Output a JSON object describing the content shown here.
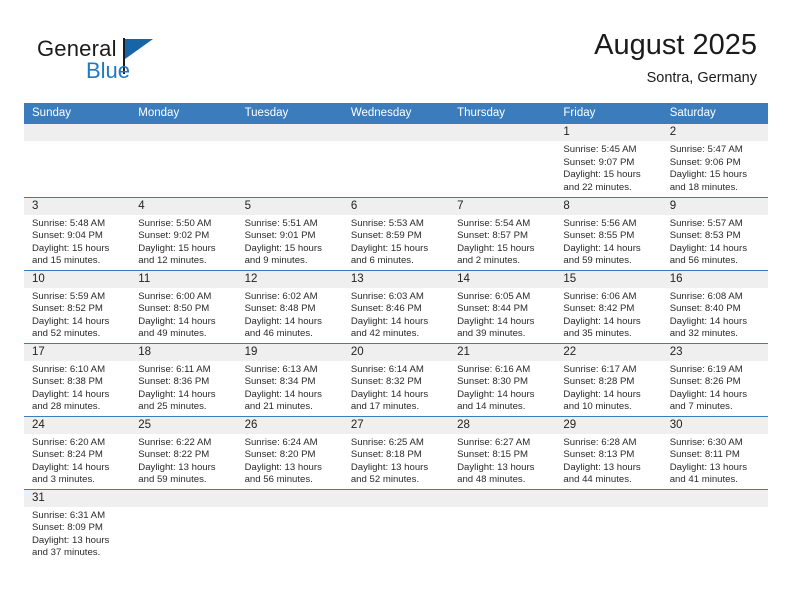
{
  "brand": {
    "name_part1": "General",
    "name_part2": "Blue",
    "flag_icon": "triangle-flag-icon",
    "accent_color": "#2079c7"
  },
  "header": {
    "title": "August 2025",
    "subtitle": "Sontra, Germany"
  },
  "theme": {
    "header_blue": "#3b7cbd",
    "daynum_band": "#efefef",
    "text": "#2a2a2a"
  },
  "weekdays": [
    "Sunday",
    "Monday",
    "Tuesday",
    "Wednesday",
    "Thursday",
    "Friday",
    "Saturday"
  ],
  "weeks": [
    [
      {
        "day": "",
        "sunrise": "",
        "sunset": "",
        "daylight_line1": "",
        "daylight_line2": ""
      },
      {
        "day": "",
        "sunrise": "",
        "sunset": "",
        "daylight_line1": "",
        "daylight_line2": ""
      },
      {
        "day": "",
        "sunrise": "",
        "sunset": "",
        "daylight_line1": "",
        "daylight_line2": ""
      },
      {
        "day": "",
        "sunrise": "",
        "sunset": "",
        "daylight_line1": "",
        "daylight_line2": ""
      },
      {
        "day": "",
        "sunrise": "",
        "sunset": "",
        "daylight_line1": "",
        "daylight_line2": ""
      },
      {
        "day": "1",
        "sunrise": "Sunrise: 5:45 AM",
        "sunset": "Sunset: 9:07 PM",
        "daylight_line1": "Daylight: 15 hours",
        "daylight_line2": "and 22 minutes."
      },
      {
        "day": "2",
        "sunrise": "Sunrise: 5:47 AM",
        "sunset": "Sunset: 9:06 PM",
        "daylight_line1": "Daylight: 15 hours",
        "daylight_line2": "and 18 minutes."
      }
    ],
    [
      {
        "day": "3",
        "sunrise": "Sunrise: 5:48 AM",
        "sunset": "Sunset: 9:04 PM",
        "daylight_line1": "Daylight: 15 hours",
        "daylight_line2": "and 15 minutes."
      },
      {
        "day": "4",
        "sunrise": "Sunrise: 5:50 AM",
        "sunset": "Sunset: 9:02 PM",
        "daylight_line1": "Daylight: 15 hours",
        "daylight_line2": "and 12 minutes."
      },
      {
        "day": "5",
        "sunrise": "Sunrise: 5:51 AM",
        "sunset": "Sunset: 9:01 PM",
        "daylight_line1": "Daylight: 15 hours",
        "daylight_line2": "and 9 minutes."
      },
      {
        "day": "6",
        "sunrise": "Sunrise: 5:53 AM",
        "sunset": "Sunset: 8:59 PM",
        "daylight_line1": "Daylight: 15 hours",
        "daylight_line2": "and 6 minutes."
      },
      {
        "day": "7",
        "sunrise": "Sunrise: 5:54 AM",
        "sunset": "Sunset: 8:57 PM",
        "daylight_line1": "Daylight: 15 hours",
        "daylight_line2": "and 2 minutes."
      },
      {
        "day": "8",
        "sunrise": "Sunrise: 5:56 AM",
        "sunset": "Sunset: 8:55 PM",
        "daylight_line1": "Daylight: 14 hours",
        "daylight_line2": "and 59 minutes."
      },
      {
        "day": "9",
        "sunrise": "Sunrise: 5:57 AM",
        "sunset": "Sunset: 8:53 PM",
        "daylight_line1": "Daylight: 14 hours",
        "daylight_line2": "and 56 minutes."
      }
    ],
    [
      {
        "day": "10",
        "sunrise": "Sunrise: 5:59 AM",
        "sunset": "Sunset: 8:52 PM",
        "daylight_line1": "Daylight: 14 hours",
        "daylight_line2": "and 52 minutes."
      },
      {
        "day": "11",
        "sunrise": "Sunrise: 6:00 AM",
        "sunset": "Sunset: 8:50 PM",
        "daylight_line1": "Daylight: 14 hours",
        "daylight_line2": "and 49 minutes."
      },
      {
        "day": "12",
        "sunrise": "Sunrise: 6:02 AM",
        "sunset": "Sunset: 8:48 PM",
        "daylight_line1": "Daylight: 14 hours",
        "daylight_line2": "and 46 minutes."
      },
      {
        "day": "13",
        "sunrise": "Sunrise: 6:03 AM",
        "sunset": "Sunset: 8:46 PM",
        "daylight_line1": "Daylight: 14 hours",
        "daylight_line2": "and 42 minutes."
      },
      {
        "day": "14",
        "sunrise": "Sunrise: 6:05 AM",
        "sunset": "Sunset: 8:44 PM",
        "daylight_line1": "Daylight: 14 hours",
        "daylight_line2": "and 39 minutes."
      },
      {
        "day": "15",
        "sunrise": "Sunrise: 6:06 AM",
        "sunset": "Sunset: 8:42 PM",
        "daylight_line1": "Daylight: 14 hours",
        "daylight_line2": "and 35 minutes."
      },
      {
        "day": "16",
        "sunrise": "Sunrise: 6:08 AM",
        "sunset": "Sunset: 8:40 PM",
        "daylight_line1": "Daylight: 14 hours",
        "daylight_line2": "and 32 minutes."
      }
    ],
    [
      {
        "day": "17",
        "sunrise": "Sunrise: 6:10 AM",
        "sunset": "Sunset: 8:38 PM",
        "daylight_line1": "Daylight: 14 hours",
        "daylight_line2": "and 28 minutes."
      },
      {
        "day": "18",
        "sunrise": "Sunrise: 6:11 AM",
        "sunset": "Sunset: 8:36 PM",
        "daylight_line1": "Daylight: 14 hours",
        "daylight_line2": "and 25 minutes."
      },
      {
        "day": "19",
        "sunrise": "Sunrise: 6:13 AM",
        "sunset": "Sunset: 8:34 PM",
        "daylight_line1": "Daylight: 14 hours",
        "daylight_line2": "and 21 minutes."
      },
      {
        "day": "20",
        "sunrise": "Sunrise: 6:14 AM",
        "sunset": "Sunset: 8:32 PM",
        "daylight_line1": "Daylight: 14 hours",
        "daylight_line2": "and 17 minutes."
      },
      {
        "day": "21",
        "sunrise": "Sunrise: 6:16 AM",
        "sunset": "Sunset: 8:30 PM",
        "daylight_line1": "Daylight: 14 hours",
        "daylight_line2": "and 14 minutes."
      },
      {
        "day": "22",
        "sunrise": "Sunrise: 6:17 AM",
        "sunset": "Sunset: 8:28 PM",
        "daylight_line1": "Daylight: 14 hours",
        "daylight_line2": "and 10 minutes."
      },
      {
        "day": "23",
        "sunrise": "Sunrise: 6:19 AM",
        "sunset": "Sunset: 8:26 PM",
        "daylight_line1": "Daylight: 14 hours",
        "daylight_line2": "and 7 minutes."
      }
    ],
    [
      {
        "day": "24",
        "sunrise": "Sunrise: 6:20 AM",
        "sunset": "Sunset: 8:24 PM",
        "daylight_line1": "Daylight: 14 hours",
        "daylight_line2": "and 3 minutes."
      },
      {
        "day": "25",
        "sunrise": "Sunrise: 6:22 AM",
        "sunset": "Sunset: 8:22 PM",
        "daylight_line1": "Daylight: 13 hours",
        "daylight_line2": "and 59 minutes."
      },
      {
        "day": "26",
        "sunrise": "Sunrise: 6:24 AM",
        "sunset": "Sunset: 8:20 PM",
        "daylight_line1": "Daylight: 13 hours",
        "daylight_line2": "and 56 minutes."
      },
      {
        "day": "27",
        "sunrise": "Sunrise: 6:25 AM",
        "sunset": "Sunset: 8:18 PM",
        "daylight_line1": "Daylight: 13 hours",
        "daylight_line2": "and 52 minutes."
      },
      {
        "day": "28",
        "sunrise": "Sunrise: 6:27 AM",
        "sunset": "Sunset: 8:15 PM",
        "daylight_line1": "Daylight: 13 hours",
        "daylight_line2": "and 48 minutes."
      },
      {
        "day": "29",
        "sunrise": "Sunrise: 6:28 AM",
        "sunset": "Sunset: 8:13 PM",
        "daylight_line1": "Daylight: 13 hours",
        "daylight_line2": "and 44 minutes."
      },
      {
        "day": "30",
        "sunrise": "Sunrise: 6:30 AM",
        "sunset": "Sunset: 8:11 PM",
        "daylight_line1": "Daylight: 13 hours",
        "daylight_line2": "and 41 minutes."
      }
    ],
    [
      {
        "day": "31",
        "sunrise": "Sunrise: 6:31 AM",
        "sunset": "Sunset: 8:09 PM",
        "daylight_line1": "Daylight: 13 hours",
        "daylight_line2": "and 37 minutes."
      },
      {
        "day": "",
        "sunrise": "",
        "sunset": "",
        "daylight_line1": "",
        "daylight_line2": ""
      },
      {
        "day": "",
        "sunrise": "",
        "sunset": "",
        "daylight_line1": "",
        "daylight_line2": ""
      },
      {
        "day": "",
        "sunrise": "",
        "sunset": "",
        "daylight_line1": "",
        "daylight_line2": ""
      },
      {
        "day": "",
        "sunrise": "",
        "sunset": "",
        "daylight_line1": "",
        "daylight_line2": ""
      },
      {
        "day": "",
        "sunrise": "",
        "sunset": "",
        "daylight_line1": "",
        "daylight_line2": ""
      },
      {
        "day": "",
        "sunrise": "",
        "sunset": "",
        "daylight_line1": "",
        "daylight_line2": ""
      }
    ]
  ]
}
